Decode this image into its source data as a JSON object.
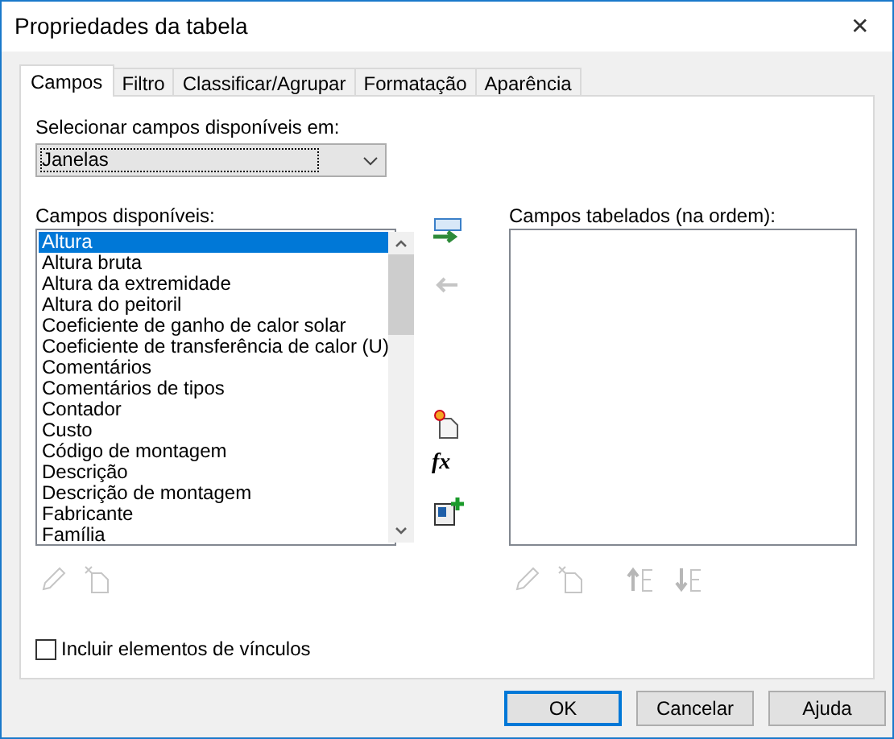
{
  "window": {
    "title": "Propriedades da tabela",
    "close": "✕"
  },
  "tabs": [
    {
      "label": "Campos",
      "selected": true
    },
    {
      "label": "Filtro",
      "selected": false
    },
    {
      "label": "Classificar/Agrupar",
      "selected": false
    },
    {
      "label": "Formatação",
      "selected": false
    },
    {
      "label": "Aparência",
      "selected": false
    }
  ],
  "source": {
    "label": "Selecionar campos disponíveis em:",
    "value": "Janelas"
  },
  "available": {
    "label": "Campos disponíveis:",
    "items": [
      {
        "label": "Altura",
        "selected": true
      },
      {
        "label": "Altura bruta",
        "selected": false
      },
      {
        "label": "Altura da extremidade",
        "selected": false
      },
      {
        "label": "Altura do peitoril",
        "selected": false
      },
      {
        "label": "Coeficiente de ganho de calor solar",
        "selected": false
      },
      {
        "label": "Coeficiente de transferência de calor (U)",
        "selected": false
      },
      {
        "label": "Comentários",
        "selected": false
      },
      {
        "label": "Comentários de tipos",
        "selected": false
      },
      {
        "label": "Contador",
        "selected": false
      },
      {
        "label": "Custo",
        "selected": false
      },
      {
        "label": "Código de montagem",
        "selected": false
      },
      {
        "label": "Descrição",
        "selected": false
      },
      {
        "label": "Descrição de montagem",
        "selected": false
      },
      {
        "label": "Fabricante",
        "selected": false
      },
      {
        "label": "Família",
        "selected": false
      }
    ]
  },
  "middle_tools": [
    {
      "kind": "add",
      "disabled": false
    },
    {
      "kind": "remove",
      "disabled": true
    },
    {
      "kind": "new",
      "disabled": false
    },
    {
      "kind": "formula",
      "label": "fx",
      "disabled": false
    },
    {
      "kind": "combine",
      "disabled": false
    }
  ],
  "scheduled": {
    "label": "Campos tabelados (na ordem):"
  },
  "left_tools": [
    {
      "kind": "edit",
      "disabled": true
    },
    {
      "kind": "delete",
      "disabled": true
    }
  ],
  "right_tools": [
    {
      "kind": "edit",
      "disabled": true
    },
    {
      "kind": "delete",
      "disabled": true
    },
    {
      "kind": "up",
      "disabled": true
    },
    {
      "kind": "down",
      "disabled": true
    }
  ],
  "include_links": {
    "label": "Incluir elementos de vínculos",
    "checked": false
  },
  "buttons": [
    {
      "label": "OK",
      "default": true
    },
    {
      "label": "Cancelar",
      "default": false
    },
    {
      "label": "Ajuda",
      "default": false
    }
  ]
}
